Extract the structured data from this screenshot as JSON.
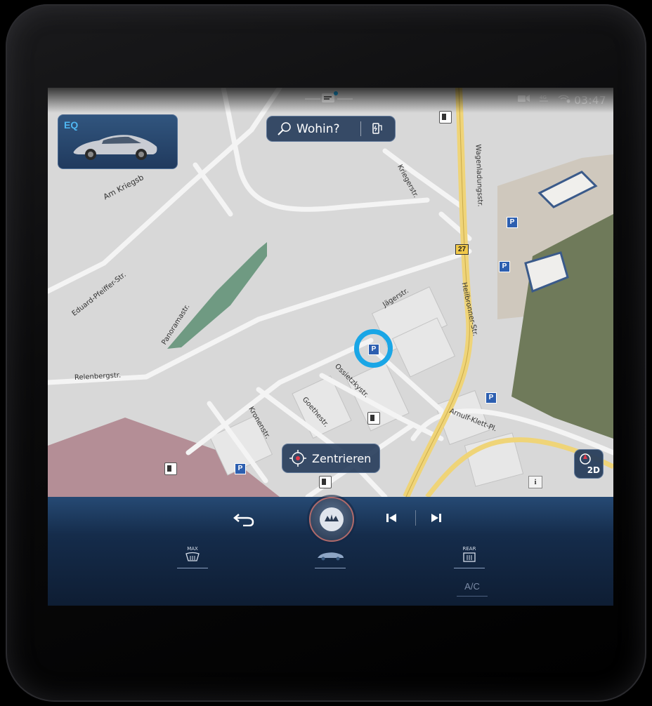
{
  "status": {
    "time": "03:47",
    "icons": [
      "camera-icon",
      "network-4g-icon",
      "wifi-location-icon"
    ]
  },
  "map": {
    "streets": [
      "Am Kriegsb",
      "Eduard-Pfeiffer-Str.",
      "Panoramastr.",
      "Relenbergstr.",
      "Jägerstr.",
      "Kriegerstr.",
      "Wagenladungsstr.",
      "Heilbronner-Str.",
      "Ossietzkystr.",
      "Goethestr.",
      "Kronenstr.",
      "Arnulf-Klett-Pl."
    ],
    "road_badge": "27",
    "info_label": "i"
  },
  "destination": {
    "label": "Wohin?"
  },
  "vehicle_card": {
    "logo": "EQ"
  },
  "center_button": {
    "label": "Zentrieren"
  },
  "view_toggle": {
    "label": "2D"
  },
  "bottom_bar": {
    "climate_left_label": "MAX",
    "climate_right_label": "REAR",
    "ac_label": "A/C"
  },
  "colors": {
    "panel": "#264a74",
    "chip": "#283e5c",
    "highlight_ring": "#1aa6e6",
    "map_bg": "#d9d9d9",
    "road_yellow": "#f0d36a"
  }
}
